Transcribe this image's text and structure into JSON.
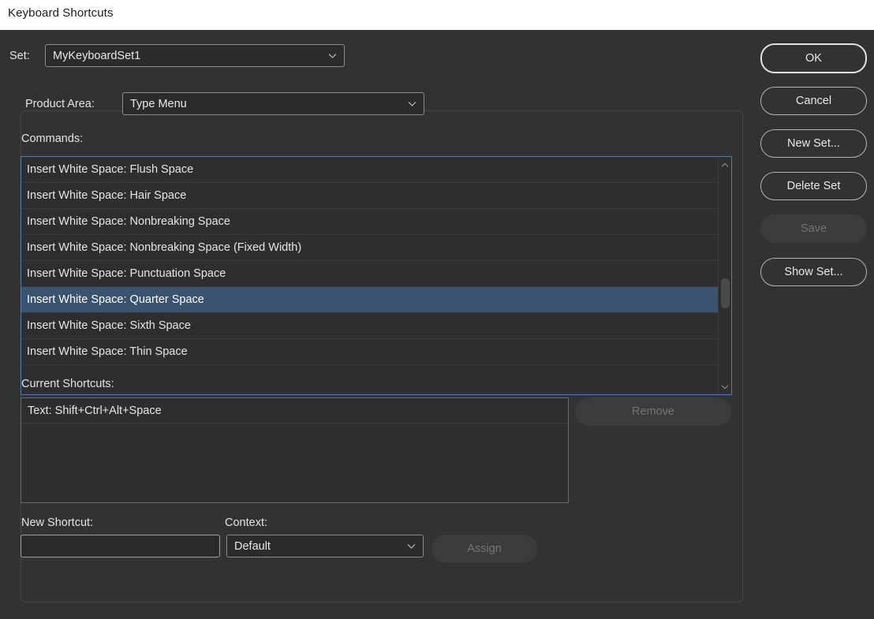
{
  "window": {
    "title": "Keyboard Shortcuts"
  },
  "colors": {
    "dialog_bg": "#323232",
    "titlebar_bg": "#ffffff",
    "selection": "#3a536e",
    "focus_border": "#4c7fb0",
    "text": "#e6e6e6",
    "disabled_text": "#757575"
  },
  "set_row": {
    "label": "Set:",
    "value": "MyKeyboardSet1"
  },
  "product_area": {
    "label": "Product Area:",
    "value": "Type Menu"
  },
  "commands": {
    "label": "Commands:",
    "selected_index": 5,
    "items": [
      "Insert White Space: Flush Space",
      "Insert White Space: Hair Space",
      "Insert White Space: Nonbreaking Space",
      "Insert White Space: Nonbreaking Space (Fixed Width)",
      "Insert White Space: Punctuation Space",
      "Insert White Space: Quarter Space",
      "Insert White Space: Sixth Space",
      "Insert White Space: Thin Space"
    ]
  },
  "current_shortcuts": {
    "label": "Current Shortcuts:",
    "items": [
      "Text: Shift+Ctrl+Alt+Space"
    ],
    "remove_label": "Remove",
    "remove_disabled": true
  },
  "new_shortcut": {
    "label": "New Shortcut:",
    "value": "",
    "placeholder": ""
  },
  "context": {
    "label": "Context:",
    "value": "Default"
  },
  "assign": {
    "label": "Assign",
    "disabled": true
  },
  "buttons": {
    "ok": "OK",
    "cancel": "Cancel",
    "new_set": "New Set...",
    "delete_set": "Delete Set",
    "save": "Save",
    "save_disabled": true,
    "show_set": "Show Set..."
  }
}
